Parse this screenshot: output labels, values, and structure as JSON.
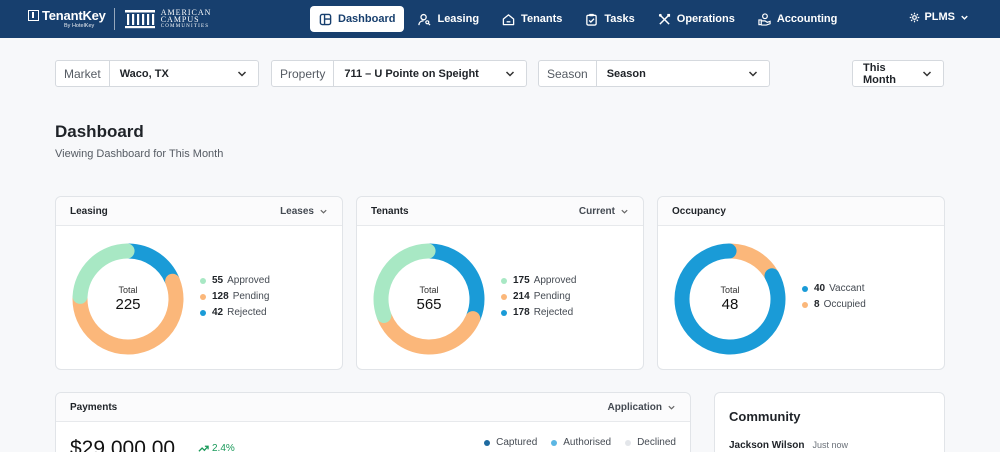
{
  "brand": {
    "tenantkey_name": "TenantKey",
    "tenantkey_sub": "By HotelKey",
    "partner_line1": "AMERICAN",
    "partner_line2": "CAMPUS",
    "partner_line3": "COMMUNITIES"
  },
  "nav": {
    "items": [
      {
        "label": "Dashboard",
        "icon": "dashboard-icon",
        "active": true
      },
      {
        "label": "Leasing",
        "icon": "user-key-icon",
        "active": false
      },
      {
        "label": "Tenants",
        "icon": "home-icon",
        "active": false
      },
      {
        "label": "Tasks",
        "icon": "clipboard-check-icon",
        "active": false
      },
      {
        "label": "Operations",
        "icon": "tools-icon",
        "active": false
      },
      {
        "label": "Accounting",
        "icon": "coins-hand-icon",
        "active": false
      }
    ],
    "account_label": "PLMS"
  },
  "filters": {
    "market_label": "Market",
    "market_value": "Waco, TX",
    "property_label": "Property",
    "property_value": "711 – U Pointe on Speight",
    "season_label": "Season",
    "season_value": "Season",
    "period_value": "This Month"
  },
  "page": {
    "title": "Dashboard",
    "subtitle": "Viewing Dashboard for This Month"
  },
  "colors": {
    "navy": "#173f6e",
    "green": "#a8e8c4",
    "orange": "#fbb77a",
    "blue": "#1a9bd7",
    "light_gray": "#d9dde2"
  },
  "leasing": {
    "title": "Leasing",
    "dropdown": "Leases",
    "total_label": "Total",
    "total": "225",
    "segments": [
      {
        "count": "55",
        "label": "Approved",
        "value": 55,
        "color": "#a8e8c4"
      },
      {
        "count": "128",
        "label": "Pending",
        "value": 128,
        "color": "#fbb77a"
      },
      {
        "count": "42",
        "label": "Rejected",
        "value": 42,
        "color": "#1a9bd7"
      }
    ]
  },
  "tenants": {
    "title": "Tenants",
    "dropdown": "Current",
    "total_label": "Total",
    "total": "565",
    "segments": [
      {
        "count": "175",
        "label": "Approved",
        "value": 175,
        "color": "#a8e8c4"
      },
      {
        "count": "214",
        "label": "Pending",
        "value": 214,
        "color": "#fbb77a"
      },
      {
        "count": "178",
        "label": "Rejected",
        "value": 178,
        "color": "#1a9bd7"
      }
    ]
  },
  "occupancy": {
    "title": "Occupancy",
    "total_label": "Total",
    "total": "48",
    "segments": [
      {
        "count": "40",
        "label": "Vaccant",
        "value": 40,
        "color": "#1a9bd7"
      },
      {
        "count": "8",
        "label": "Occupied",
        "value": 8,
        "color": "#fbb77a"
      }
    ]
  },
  "payments": {
    "title": "Payments",
    "dropdown": "Application",
    "amount": "$29,000.00",
    "change": "2.4%",
    "legend": [
      {
        "label": "Captured",
        "color": "#1e6aa0"
      },
      {
        "label": "Authorised",
        "color": "#5bb6e3"
      },
      {
        "label": "Declined",
        "color": "#e3e6ea"
      }
    ]
  },
  "community": {
    "title": "Community",
    "name": "Jackson Wilson",
    "time": "Just now"
  }
}
